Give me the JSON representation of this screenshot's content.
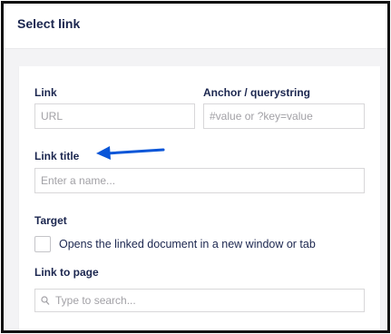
{
  "dialog": {
    "title": "Select link"
  },
  "form": {
    "link": {
      "label": "Link",
      "placeholder": "URL",
      "value": ""
    },
    "anchor": {
      "label": "Anchor / querystring",
      "placeholder": "#value or ?key=value",
      "value": ""
    },
    "link_title": {
      "label": "Link title",
      "placeholder": "Enter a name...",
      "value": ""
    },
    "target": {
      "label": "Target",
      "checkbox_label": "Opens the linked document in a new window or tab",
      "checked": false
    },
    "link_to_page": {
      "label": "Link to page",
      "search_placeholder": "Type to search..."
    }
  },
  "annotation": {
    "arrow_color": "#0a56d8"
  },
  "colors": {
    "text": "#1b264f",
    "placeholder": "#a2a1a6",
    "border": "#d8d7d9",
    "background": "#f3f3f5"
  }
}
